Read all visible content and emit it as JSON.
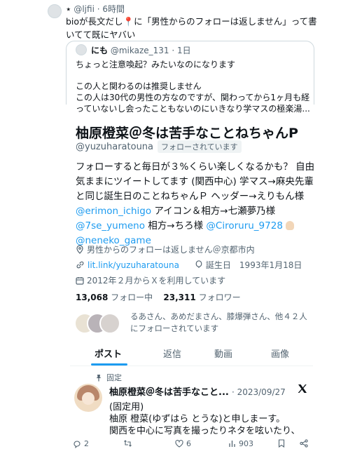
{
  "tweet": {
    "author_name": "⋆",
    "author_handle": "@ljfii",
    "time": "6時間",
    "text_line1": "bioが長文だし📍に「男性からのフォローは返しません」って書",
    "text_line2": "いてて既にヤバい"
  },
  "quote": {
    "name": "にも",
    "handle": "@mikaze_131",
    "time": "1日",
    "line1": "ちょっと注意喚起？みたいなのになります",
    "line2": "この人と関わるのは推奨しません",
    "line3": "この人は30代の男性の方なのですが、関わってから1ヶ月も経",
    "line4": "っていないし会ったこともないのにいきなり学マスの極楽湯..."
  },
  "profile": {
    "name": "柚原橙菜＠冬は苦手なことねちゃんP",
    "handle": "@yuzuharatouna",
    "follows_you": "フォローされています",
    "bio_line1": "フォローすると毎日が３%くらい楽しくなるかも？ 自由",
    "bio_line2": "気ままにツイートしてます (関西中心) 学マス→麻央先輩",
    "bio_line3": "と同じ誕生日のことねちゃんＰ ヘッダー→えりもん様",
    "mention1": "@erimon_ichigo",
    "bio_line4_rest": " アイコン＆相方→七瀬夢乃様",
    "mention2": "@7se_yumeno",
    "bio_line5_mid": " 相方→ちろ様 ",
    "mention3": "@Ciroruru_9728",
    "mention4": "@neneko_game",
    "location": "男性からのフォローは返しません＠京都市内",
    "link": "lit.link/yuzuharatouna",
    "birthday": "誕生日　1993年1月18日",
    "joined": "2012年２月からＸを利用しています",
    "following_count": "13,068",
    "following_label": "フォロー中",
    "followers_count": "23,311",
    "followers_label": "フォロワー",
    "followed_by_line1": "るあさん、あめだまさん、膝爆弾さん、他４２人",
    "followed_by_line2": "にフォローされています"
  },
  "tabs": [
    "ポスト",
    "返信",
    "動画",
    "画像"
  ],
  "pinned": {
    "label": "固定",
    "name": "柚原橙菜＠冬は苦手なこと...",
    "date": "· 2023/09/27",
    "line1": "(固定用)",
    "line2": "柚原 橙菜(ゆずはら とうな)と申しまーす。",
    "line3": "関西を中心に写真を撮ったりネタを呟いたり、"
  },
  "footer": {
    "replies": "2",
    "retweets": "",
    "likes": "6",
    "views": "903"
  },
  "colors": {
    "accent": "#1d9bf0",
    "text": "#0f1419",
    "muted": "#536471"
  }
}
